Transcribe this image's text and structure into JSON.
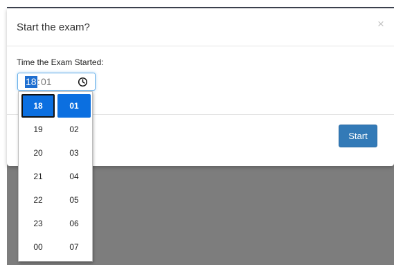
{
  "modal": {
    "title": "Start the exam?",
    "close_glyph": "×",
    "field_label": "Time the Exam Started:",
    "time": {
      "hour": "18",
      "separator": ":",
      "minute": "01"
    },
    "start_label": "Start"
  },
  "picker": {
    "hours": [
      "18",
      "19",
      "20",
      "21",
      "22",
      "23",
      "00"
    ],
    "minutes": [
      "01",
      "02",
      "03",
      "04",
      "05",
      "06",
      "07"
    ],
    "selected_hour": "18",
    "selected_minute": "01"
  },
  "colors": {
    "primary_button": "#337ab7",
    "selected_cell": "#0b6fe0",
    "backdrop": "#7d7d7d"
  },
  "icons": {
    "close": "close-icon",
    "clock": "clock-icon"
  }
}
